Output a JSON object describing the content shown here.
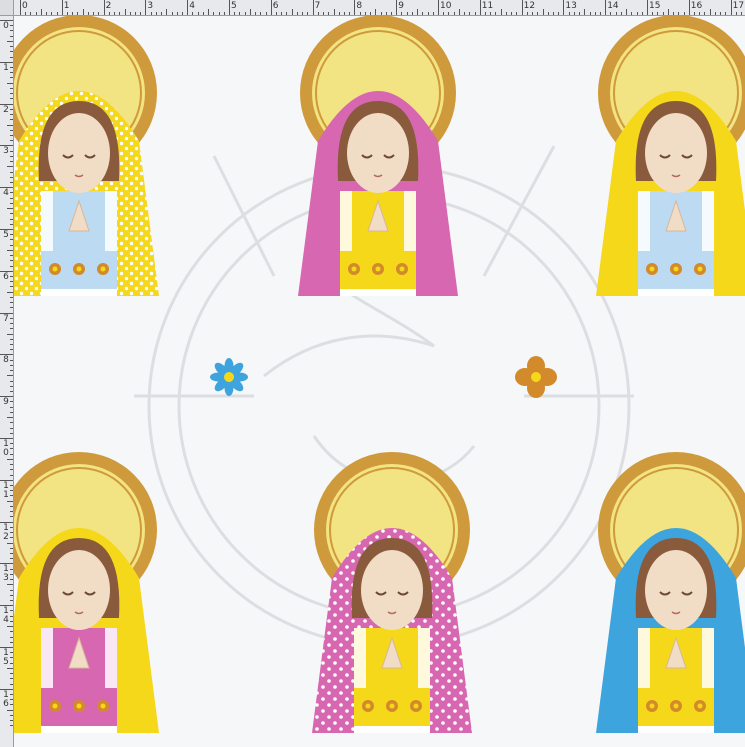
{
  "ruler": {
    "top_labels": [
      "0",
      "1",
      "2",
      "3",
      "4",
      "5",
      "6",
      "7",
      "8",
      "9",
      "10",
      "11",
      "12",
      "13",
      "14",
      "15",
      "16",
      "17"
    ],
    "left_labels": [
      "0",
      "1",
      "2",
      "3",
      "4",
      "5",
      "6",
      "7",
      "8",
      "9",
      "10",
      "11",
      "12",
      "13",
      "14",
      "15",
      "16"
    ]
  },
  "pattern": {
    "motif": "praying-virgin-mary",
    "colors": {
      "background": "#f6f7f9",
      "halo_outer": "#cf9a3c",
      "halo_inner": "#f2e383",
      "hair": "#8a5a3c",
      "skin": "#f1dcc6",
      "yellow": "#f5d81a",
      "pink": "#d867b1",
      "blue": "#3ea4dd",
      "light_blue": "#bcdaf1",
      "flower_orange": "#d28a2b"
    },
    "figures": [
      {
        "veil": "yellow-dotted",
        "dress": "light-blue"
      },
      {
        "veil": "pink",
        "dress": "yellow"
      },
      {
        "veil": "yellow",
        "dress": "light-blue"
      },
      {
        "veil": "yellow",
        "dress": "pink"
      },
      {
        "veil": "pink-dotted",
        "dress": "yellow"
      },
      {
        "veil": "blue",
        "dress": "yellow"
      }
    ],
    "flowers": [
      {
        "icon": "blue-flower-icon"
      },
      {
        "icon": "orange-flower-icon"
      }
    ]
  }
}
